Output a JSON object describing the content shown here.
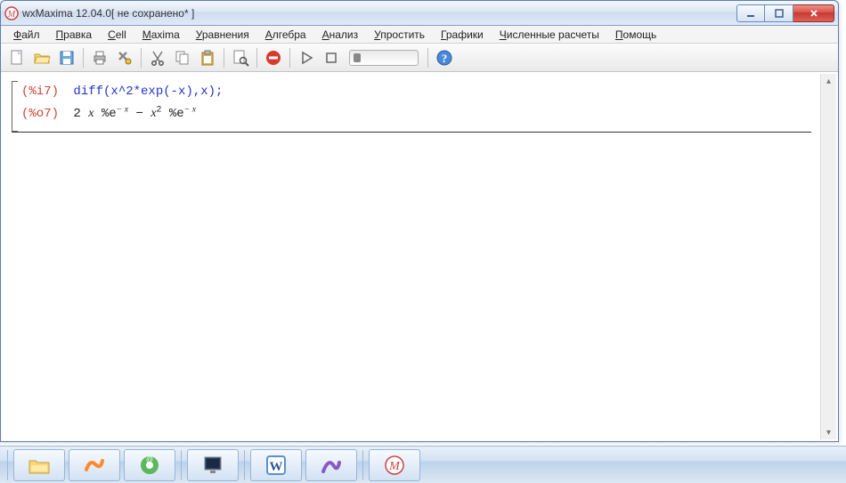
{
  "window": {
    "title": "wxMaxima 12.04.0[ не сохранено* ]"
  },
  "menu": {
    "items": [
      {
        "label": "Файл",
        "accel": "Ф"
      },
      {
        "label": "Правка",
        "accel": "П"
      },
      {
        "label": "Cell",
        "accel": "C"
      },
      {
        "label": "Maxima",
        "accel": "M"
      },
      {
        "label": "Уравнения",
        "accel": "У"
      },
      {
        "label": "Алгебра",
        "accel": "А"
      },
      {
        "label": "Анализ",
        "accel": "А"
      },
      {
        "label": "Упростить",
        "accel": "У"
      },
      {
        "label": "Графики",
        "accel": "Г"
      },
      {
        "label": "Численные расчеты",
        "accel": "Ч"
      },
      {
        "label": "Помощь",
        "accel": "П"
      }
    ]
  },
  "toolbar": {
    "new": "new-doc-icon",
    "open": "open-folder-icon",
    "save": "save-icon",
    "print": "print-icon",
    "prefs": "preferences-icon",
    "cut": "cut-icon",
    "copy": "copy-icon",
    "paste": "paste-icon",
    "find": "find-icon",
    "stop": "stop-icon",
    "play": "play-icon",
    "interrupt": "interrupt-icon",
    "slider": "anim-slider",
    "help": "help-icon"
  },
  "cell": {
    "in_label": "(%i7)",
    "in_code": "diff(x^2*exp(-x),x);",
    "out_label": "(%o7)",
    "out_prefix": "2 ",
    "out_x": "x",
    "out_e": " %e",
    "out_exp1": "− x",
    "out_minus": " − ",
    "out_x2": "x",
    "out_sq": "2",
    "out_e2": " %e",
    "out_exp2": "− x"
  }
}
